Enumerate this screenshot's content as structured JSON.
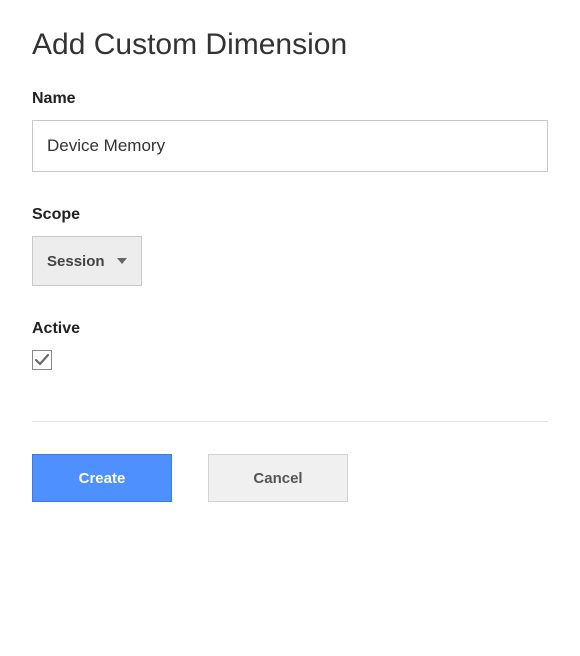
{
  "title": "Add Custom Dimension",
  "fields": {
    "name": {
      "label": "Name",
      "value": "Device Memory"
    },
    "scope": {
      "label": "Scope",
      "selected": "Session"
    },
    "active": {
      "label": "Active",
      "checked": true
    }
  },
  "buttons": {
    "create": "Create",
    "cancel": "Cancel"
  }
}
